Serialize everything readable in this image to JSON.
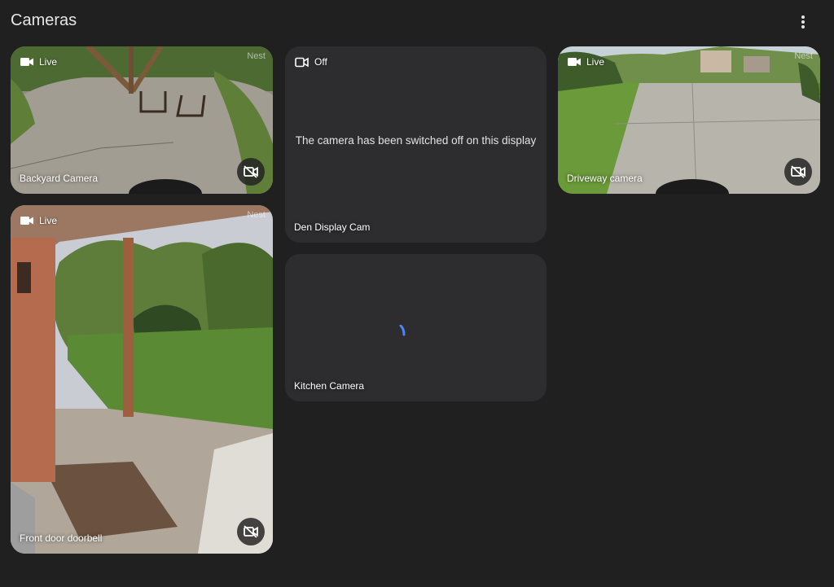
{
  "page": {
    "title": "Cameras",
    "menu_icon": "more-vert-icon"
  },
  "colors": {
    "background": "#202020",
    "card": "#2d2d2f",
    "accent": "#4f86f7"
  },
  "cameras": [
    {
      "name": "Backyard Camera",
      "status": "Live",
      "brand": "Nest",
      "status_icon": "videocam-icon",
      "action_icon": "videocam-off-icon"
    },
    {
      "name": "Den Display Cam",
      "status": "Off",
      "message": "The camera has been switched off on this display",
      "status_icon": "videocam-outline-icon"
    },
    {
      "name": "Driveway camera",
      "status": "Live",
      "brand": "Nest",
      "status_icon": "videocam-icon",
      "action_icon": "videocam-off-icon"
    },
    {
      "name": "Front door doorbell",
      "status": "Live",
      "brand": "Nest",
      "status_icon": "videocam-icon",
      "action_icon": "videocam-off-icon"
    },
    {
      "name": "Kitchen Camera",
      "state": "loading",
      "indicator_icon": "loading-spinner-icon"
    }
  ]
}
